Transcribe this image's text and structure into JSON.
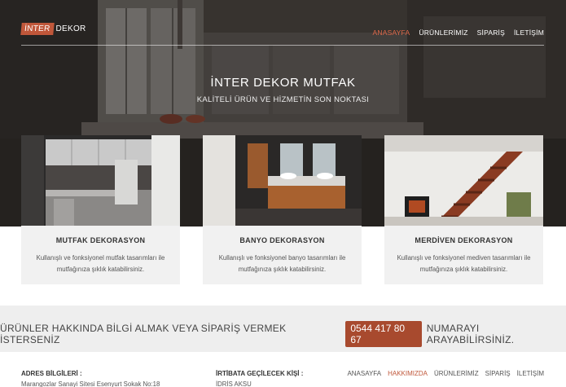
{
  "brand": {
    "badge": "İNTER",
    "rest": "DEKOR"
  },
  "nav": {
    "items": [
      {
        "label": "ANASAYFA",
        "active": true
      },
      {
        "label": "ÜRÜNLERİMİZ"
      },
      {
        "label": "SİPARİŞ"
      },
      {
        "label": "İLETİŞİM"
      }
    ]
  },
  "hero": {
    "title": "İNTER DEKOR MUTFAK",
    "subtitle": "KALİTELİ ÜRÜN VE HİZMETİN SON NOKTASI"
  },
  "cards": [
    {
      "title": "MUTFAK DEKORASYON",
      "line1": "Kullanışlı ve fonksiyonel mutfak tasarımları ile",
      "line2": "mutfağınıza şıklık katabilirsiniz."
    },
    {
      "title": "BANYO DEKORASYON",
      "line1": "Kullanışlı ve fonksiyonel banyo tasarımları ile",
      "line2": "mutfağınıza şıklık katabilirsiniz."
    },
    {
      "title": "MERDİVEN DEKORASYON",
      "line1": "Kullanışlı ve fonksiyonel mediven tasarımları ile",
      "line2": "mutfağınıza şıklık katabilirsiniz."
    }
  ],
  "cta": {
    "before": "ÜRÜNLER HAKKINDA BİLGİ ALMAK VEYA SİPARİŞ VERMEK İSTERSENİZ",
    "phone": "0544 417 80 67",
    "after": "NUMARAYI ARAYABİLİRSİNİZ."
  },
  "footer": {
    "address_heading": "ADRES BİLGİLERİ :",
    "address_line": "Marangozlar Sanayi Sitesi Esenyurt Sokak No:18",
    "contact_heading": "İRTİBATA GEÇİLECEK KİŞİ :",
    "contact_name": "İDRİS AKSU",
    "nav": [
      {
        "label": "ANASAYFA"
      },
      {
        "label": "HAKKIMIZDA",
        "active": true
      },
      {
        "label": "ÜRÜNLERİMİZ"
      },
      {
        "label": "SİPARİŞ"
      },
      {
        "label": "İLETİŞİM"
      }
    ]
  },
  "colors": {
    "accent": "#e0694a",
    "phone_bg": "#a84a2e",
    "logo_badge": "#c0573a"
  }
}
